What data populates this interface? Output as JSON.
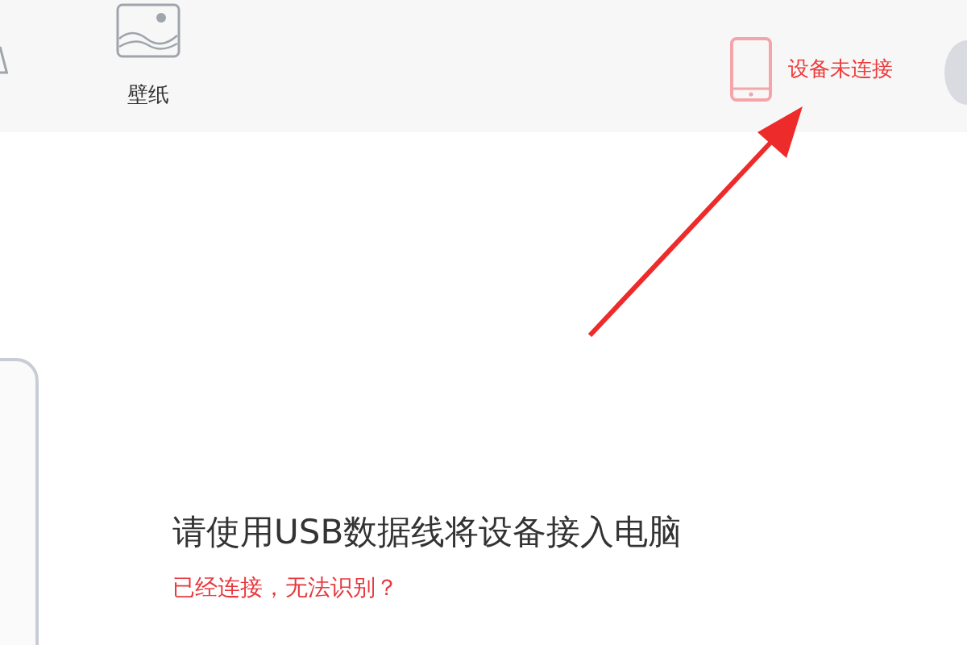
{
  "toolbar": {
    "items": [
      {
        "label": "壁纸"
      }
    ],
    "device_status": {
      "label": "设备未连接"
    }
  },
  "main": {
    "heading": "请使用USB数据线将设备接入电脑",
    "help_link": "已经连接，无法识别？"
  }
}
